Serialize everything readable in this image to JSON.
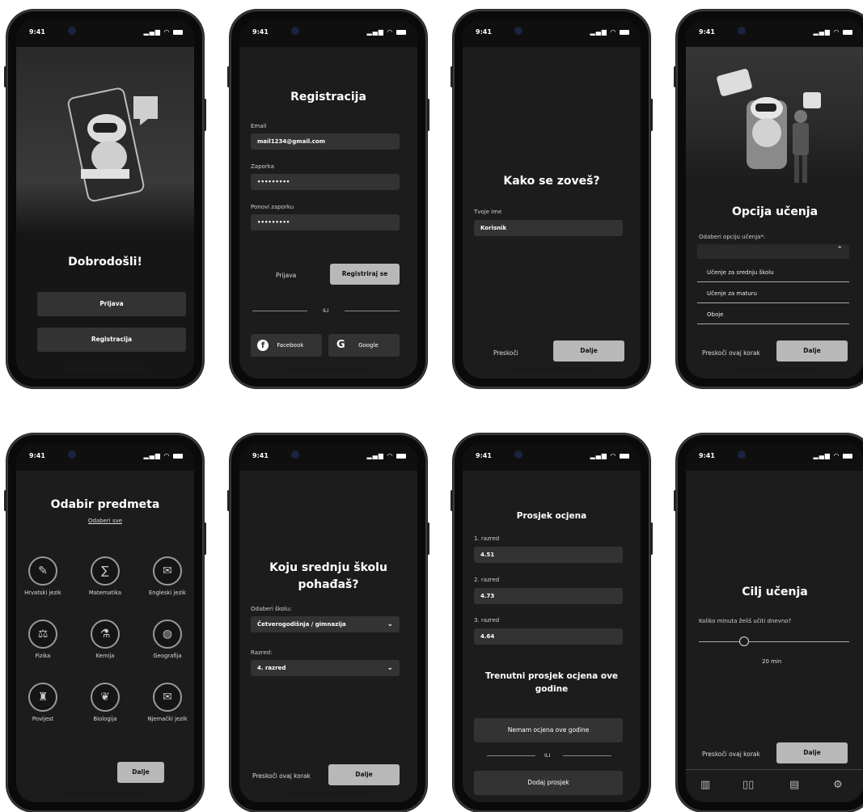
{
  "status": {
    "time": "9:41"
  },
  "s1": {
    "title": "Dobrodošli!",
    "login": "Prijava",
    "register": "Registracija"
  },
  "s2": {
    "title": "Registracija",
    "email_label": "Email",
    "email_value": "mail1234@gmail.com",
    "pass_label": "Zaporka",
    "pass_value": "•••••••••",
    "repeat_label": "Ponovi zaporku",
    "repeat_value": "•••••••••",
    "login": "Prijava",
    "register": "Registriraj se",
    "or": "ILI",
    "facebook": "Facebook",
    "google": "Google"
  },
  "s3": {
    "title": "Kako se zoveš?",
    "name_label": "Tvoje ime",
    "name_value": "Korisnik",
    "skip": "Preskoči",
    "next": "Dalje"
  },
  "s4": {
    "title": "Opcija učenja",
    "select_label": "Odaberi opciju učenja*:",
    "options": [
      "Učenje za srednju školu",
      "Učenje za maturu",
      "Oboje"
    ],
    "skip": "Preskoči ovaj korak",
    "next": "Dalje"
  },
  "s5": {
    "title": "Odabir predmeta",
    "select_all": "Odaberi sve",
    "subjects": [
      "Hrvatski jezik",
      "Matematika",
      "Engleski jezik",
      "Fizika",
      "Kemija",
      "Geografija",
      "Povijest",
      "Biologija",
      "Njemački jezik"
    ],
    "next": "Dalje"
  },
  "s6": {
    "title_line1": "Koju srednju školu",
    "title_line2": "pohađaš?",
    "school_label": "Odaberi školu:",
    "school_value": "Četverogodišnja / gimnazija",
    "grade_label": "Razred:",
    "grade_value": "4. razred",
    "skip": "Preskoči ovaj korak",
    "next": "Dalje"
  },
  "s7": {
    "title": "Prosjek ocjena",
    "grades": [
      {
        "label": "1. razred",
        "value": "4.51"
      },
      {
        "label": "2. razred",
        "value": "4.73"
      },
      {
        "label": "3. razred",
        "value": "4.64"
      }
    ],
    "current_line1": "Trenutni prosjek ocjena ove",
    "current_line2": "godine",
    "no_grades": "Nemam ocjena ove godine",
    "or": "ILI",
    "add": "Dodaj prosjek"
  },
  "s8": {
    "title": "Cilj učenja",
    "question": "Koliko minuta želiš učiti dnevno?",
    "slider_fraction": 0.3,
    "slider_value": "20 min",
    "skip": "Preskoči ovaj korak",
    "next": "Dalje",
    "nav_icons": [
      "chart-icon",
      "book-icon",
      "notes-icon",
      "gear-icon"
    ]
  }
}
